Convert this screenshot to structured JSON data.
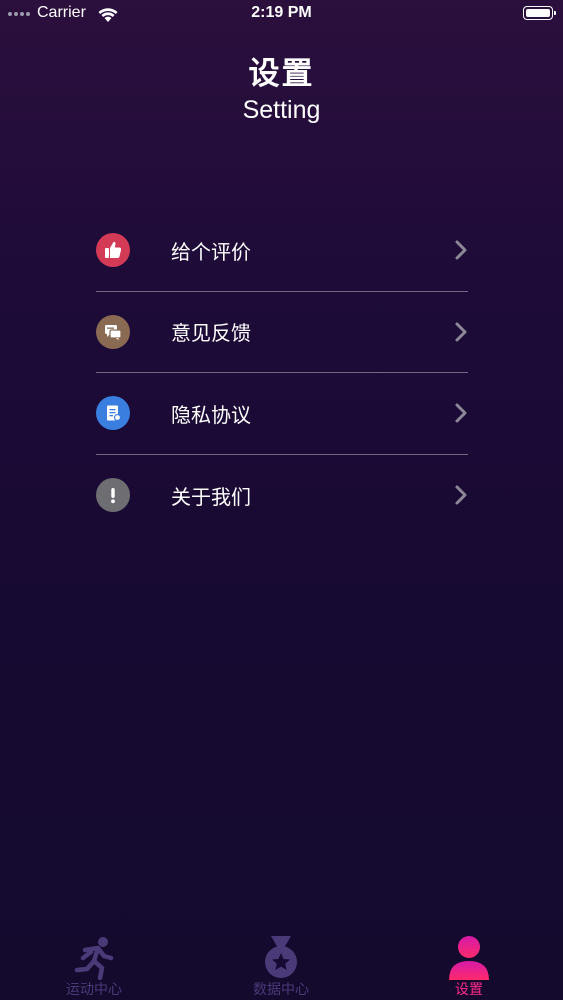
{
  "status_bar": {
    "carrier": "Carrier",
    "time": "2:19 PM"
  },
  "header": {
    "title": "设置",
    "subtitle": "Setting"
  },
  "menu": {
    "items": [
      {
        "label": "给个评价",
        "icon": "thumbs-up-icon",
        "color": "#d23a55"
      },
      {
        "label": "意见反馈",
        "icon": "feedback-chat-icon",
        "color": "#8a6a52"
      },
      {
        "label": "隐私协议",
        "icon": "document-icon",
        "color": "#3a7fe0"
      },
      {
        "label": "关于我们",
        "icon": "exclamation-icon",
        "color": "#6e6e72"
      }
    ]
  },
  "tab_bar": {
    "tabs": [
      {
        "label": "运动中心",
        "icon": "running-person-icon",
        "active": false
      },
      {
        "label": "数据中心",
        "icon": "medal-icon",
        "active": false
      },
      {
        "label": "设置",
        "icon": "person-icon",
        "active": true
      }
    ],
    "active_color": "#ff2a8a",
    "inactive_color": "#4a3a78"
  }
}
